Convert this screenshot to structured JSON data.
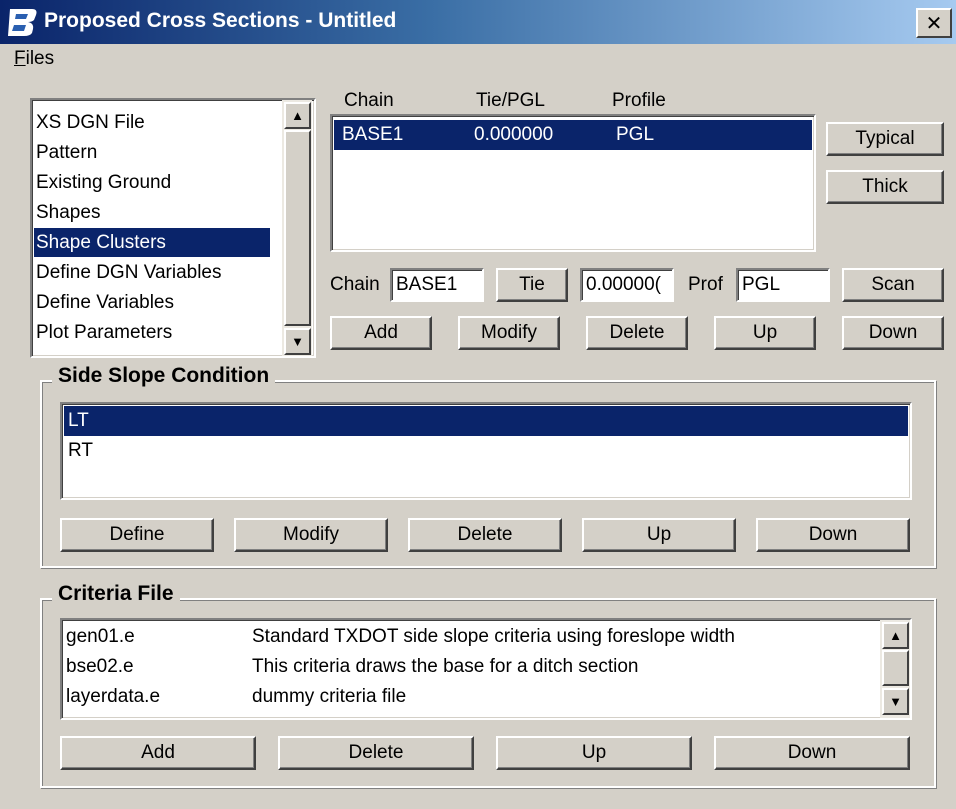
{
  "window": {
    "title": "Proposed Cross Sections - Untitled",
    "close_label": "✕",
    "app_icon": "bentley-b-icon"
  },
  "menu": {
    "files_underline": "F",
    "files_rest": "iles"
  },
  "nav_list": {
    "items": [
      "XS DGN File",
      "Pattern",
      "Existing Ground",
      "Shapes",
      "Shape Clusters",
      "Define DGN Variables",
      "Define Variables",
      "Plot Parameters"
    ],
    "selected": "Shape Clusters"
  },
  "chain_table": {
    "headers": [
      "Chain",
      "Tie/PGL",
      "Profile"
    ],
    "rows": [
      {
        "chain": "BASE1",
        "tie": "0.000000",
        "profile": "PGL"
      }
    ]
  },
  "buttons_right": {
    "typical": "Typical",
    "thick": "Thick",
    "scan": "Scan"
  },
  "chain_entry": {
    "chain_label": "Chain",
    "chain_value": "BASE1",
    "tie_button": "Tie",
    "tie_value": "0.00000(",
    "prof_label": "Prof",
    "prof_value": "PGL"
  },
  "chain_actions": {
    "add": "Add",
    "modify": "Modify",
    "delete": "Delete",
    "up": "Up",
    "down": "Down"
  },
  "side_slope": {
    "title": "Side Slope Condition",
    "items": [
      "LT",
      "RT"
    ],
    "selected": "LT",
    "actions": {
      "define": "Define",
      "modify": "Modify",
      "delete": "Delete",
      "up": "Up",
      "down": "Down"
    }
  },
  "criteria": {
    "title": "Criteria File",
    "rows": [
      {
        "file": "gen01.e",
        "desc": "Standard TXDOT side slope criteria using foreslope width"
      },
      {
        "file": "bse02.e",
        "desc": "This criteria draws the base for a ditch section"
      },
      {
        "file": "layerdata.e",
        "desc": "dummy criteria file"
      }
    ],
    "actions": {
      "add": "Add",
      "delete": "Delete",
      "up": "Up",
      "down": "Down"
    }
  },
  "colors": {
    "selection": "#0a246a",
    "face": "#d4d0c8"
  }
}
